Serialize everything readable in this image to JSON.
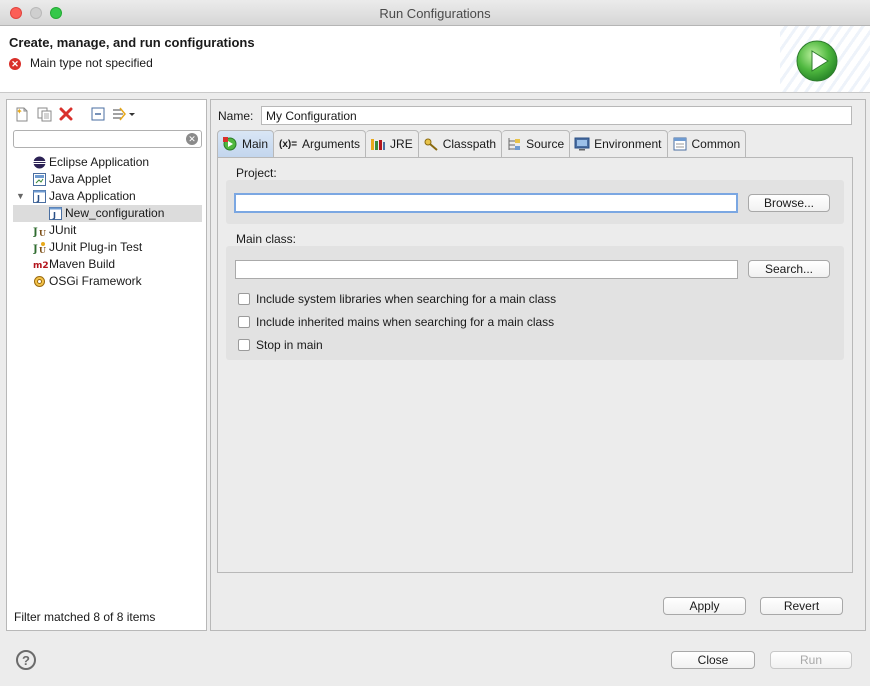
{
  "window": {
    "title": "Run Configurations"
  },
  "banner": {
    "title": "Create, manage, and run configurations",
    "message": "Main type not specified"
  },
  "left": {
    "toolbar": [
      "new-config-icon",
      "duplicate-icon",
      "delete-icon",
      "collapse-all-icon",
      "filter-icon"
    ],
    "filter_placeholder": "",
    "tree": [
      {
        "label": "Eclipse Application",
        "icon": "eclipse-icon",
        "indent": 0
      },
      {
        "label": "Java Applet",
        "icon": "java-applet-icon",
        "indent": 0
      },
      {
        "label": "Java Application",
        "icon": "java-application-icon",
        "indent": 0,
        "expanded": true
      },
      {
        "label": "New_configuration",
        "icon": "java-application-icon",
        "indent": 1,
        "selected": true
      },
      {
        "label": "JUnit",
        "icon": "junit-icon",
        "indent": 0
      },
      {
        "label": "JUnit Plug-in Test",
        "icon": "junit-plugin-icon",
        "indent": 0
      },
      {
        "label": "Maven Build",
        "icon": "maven-icon",
        "indent": 0
      },
      {
        "label": "OSGi Framework",
        "icon": "osgi-icon",
        "indent": 0
      }
    ],
    "status": "Filter matched 8 of 8 items"
  },
  "right": {
    "name_label": "Name:",
    "name_value": "My Configuration",
    "tabs": [
      {
        "label": "Main",
        "icon": "main-tab-icon",
        "active": true
      },
      {
        "label": "Arguments",
        "icon": "arguments-icon"
      },
      {
        "label": "JRE",
        "icon": "jre-icon"
      },
      {
        "label": "Classpath",
        "icon": "classpath-icon"
      },
      {
        "label": "Source",
        "icon": "source-icon"
      },
      {
        "label": "Environment",
        "icon": "environment-icon"
      },
      {
        "label": "Common",
        "icon": "common-icon"
      }
    ],
    "project_label": "Project:",
    "project_value": "",
    "browse_label": "Browse...",
    "main_class_label": "Main class:",
    "main_class_value": "",
    "search_label": "Search...",
    "checkboxes": [
      {
        "label": "Include system libraries when searching for a main class",
        "checked": false
      },
      {
        "label": "Include inherited mains when searching for a main class",
        "checked": false
      },
      {
        "label": "Stop in main",
        "checked": false
      }
    ],
    "apply_label": "Apply",
    "revert_label": "Revert"
  },
  "footer": {
    "close_label": "Close",
    "run_label": "Run"
  },
  "colors": {
    "error": "#d9302b",
    "run_green": "#3aa63a",
    "active_tab": "#c3d6ee",
    "focus_ring": "#7ba7e2"
  }
}
